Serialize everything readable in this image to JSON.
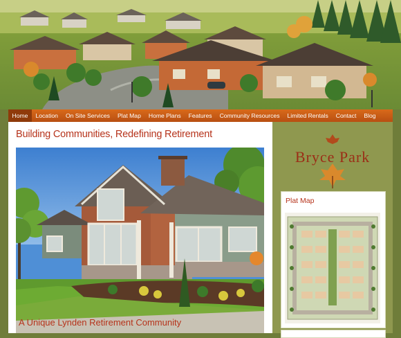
{
  "nav": {
    "items": [
      "Home",
      "Location",
      "On Site Services",
      "Plat Map",
      "Home Plans",
      "Features",
      "Community Resources",
      "Limited Rentals",
      "Contact",
      "Blog"
    ],
    "active_index": 0
  },
  "main": {
    "headline": "Building Communities, Redefining Retirement",
    "subheadline": "A Unique Lynden Retirement Community"
  },
  "sidebar": {
    "logo_text": "Bryce Park",
    "plat_map_title": "Plat Map"
  },
  "colors": {
    "accent_red": "#b6331b",
    "nav_orange": "#d96a1a",
    "frame_olive": "#6f7d3a"
  }
}
